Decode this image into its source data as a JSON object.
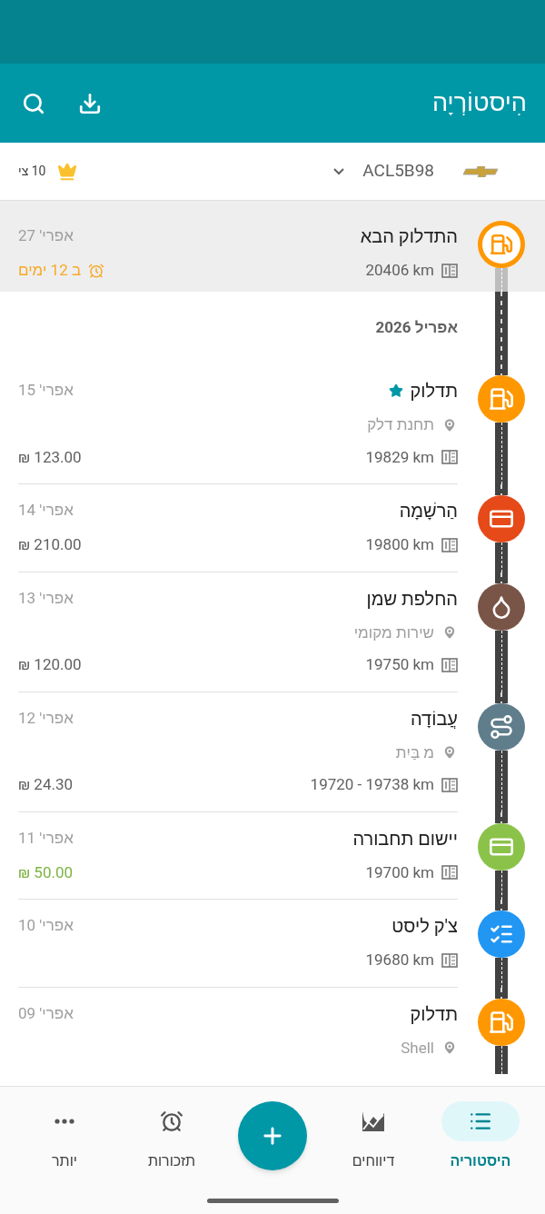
{
  "app_bar": {
    "title": "הִיסטוֹרְיָה"
  },
  "vehicle": {
    "plate": "ACL5B98",
    "points": "10 צי"
  },
  "next_fill": {
    "title": "התדלוק הבא",
    "date": "אפרי' 27",
    "odometer": "20406 km",
    "due": "ב 12 ימים"
  },
  "month": "אפריל 2026",
  "entries": [
    {
      "kind": "fuel",
      "color": "#ff9800",
      "title": "תדלוק",
      "starred": true,
      "date": "אפרי' 15",
      "location": "תחנת דלק",
      "odometer": "19829 km",
      "amount": "123.00 ₪"
    },
    {
      "kind": "expense",
      "color": "#e64a19",
      "title": "הַרשָׁמָה",
      "starred": false,
      "date": "אפרי' 14",
      "odometer": "19800 km",
      "amount": "210.00 ₪"
    },
    {
      "kind": "service",
      "color": "#795548",
      "title": "החלפת שמן",
      "starred": false,
      "date": "אפרי' 13",
      "location": "שירות מקומי",
      "odometer": "19750 km",
      "amount": "120.00 ₪"
    },
    {
      "kind": "trip",
      "color": "#607d8b",
      "title": "עֲבוֹדָה",
      "starred": false,
      "date": "אפרי' 12",
      "location": "מ בַּיִת",
      "odometer": "19720 - 19738 km",
      "amount": "24.30 ₪"
    },
    {
      "kind": "income",
      "color": "#8bc34a",
      "title": "יישום תחבורה",
      "starred": false,
      "date": "אפרי' 11",
      "odometer": "19700 km",
      "amount": "50.00 ₪"
    },
    {
      "kind": "checklist",
      "color": "#2196f3",
      "title": "צ'ק ליסט",
      "starred": false,
      "date": "אפרי' 10",
      "odometer": "19680 km"
    },
    {
      "kind": "fuel",
      "color": "#ff9800",
      "title": "תדלוק",
      "starred": false,
      "date": "אפרי' 09",
      "location": "Shell"
    }
  ],
  "nav": [
    {
      "kind": "tab",
      "label": "היסטוריה",
      "selected": true
    },
    {
      "kind": "tab",
      "label": "דיווחים",
      "selected": false
    },
    {
      "kind": "fab"
    },
    {
      "kind": "tab",
      "label": "תזכורות",
      "selected": false
    },
    {
      "kind": "tab",
      "label": "יותר",
      "selected": false
    }
  ]
}
